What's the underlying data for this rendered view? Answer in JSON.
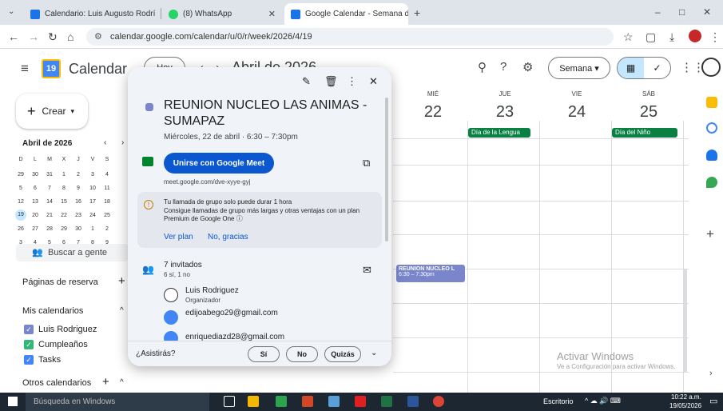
{
  "browser": {
    "tabs": [
      {
        "title": "Calendario: Luis Augusto Rodrí",
        "color": "#1a73e8"
      },
      {
        "title": "(8) WhatsApp",
        "color": "#25d366"
      },
      {
        "title": "Google Calendar - Semana del",
        "color": "#1a73e8"
      }
    ],
    "url": "calendar.google.com/calendar/u/0/r/week/2026/4/19",
    "new_tab": "+",
    "win_min": "–",
    "win_max": "□",
    "win_close": "✕"
  },
  "header": {
    "app_name": "Calendar",
    "logo_day": "19",
    "today_btn": "Hoy",
    "month_title": "Abril de 2026",
    "view_select": "Semana ▾"
  },
  "sidebar": {
    "create_label": "Crear",
    "mini_month": "Abril de 2026",
    "weekday_initials": [
      "D",
      "L",
      "M",
      "X",
      "J",
      "V",
      "S"
    ],
    "weeks": [
      [
        "29",
        "30",
        "31",
        "1",
        "2",
        "3",
        "4"
      ],
      [
        "5",
        "6",
        "7",
        "8",
        "9",
        "10",
        "11"
      ],
      [
        "12",
        "13",
        "14",
        "15",
        "16",
        "17",
        "18"
      ],
      [
        "19",
        "20",
        "21",
        "22",
        "23",
        "24",
        "25"
      ],
      [
        "26",
        "27",
        "28",
        "29",
        "30",
        "1",
        "2"
      ],
      [
        "3",
        "4",
        "5",
        "6",
        "7",
        "8",
        "9"
      ]
    ],
    "search_people": "Buscar a gente",
    "booking_pages": "Páginas de reserva",
    "my_calendars": "Mis calendarios",
    "calendars": [
      {
        "name": "Luis Rodriguez",
        "color": "#7986cb"
      },
      {
        "name": "Cumpleaños",
        "color": "#33b679"
      },
      {
        "name": "Tasks",
        "color": "#4285f4"
      }
    ],
    "other_calendars": "Otros calendarios"
  },
  "grid": {
    "days": [
      {
        "name": "MIÉ",
        "num": "22"
      },
      {
        "name": "JUE",
        "num": "23"
      },
      {
        "name": "VIE",
        "num": "24"
      },
      {
        "name": "SÁB",
        "num": "25"
      }
    ],
    "allday_events": [
      {
        "title": "Día de la Lengua"
      },
      {
        "title": "Día del Niño"
      }
    ],
    "event": {
      "title": "REUNION NUCLEO L",
      "time": "6:30 – 7:30pm",
      "color": "#7986cb"
    },
    "watermark_title": "Activar Windows",
    "watermark_sub": "Ve a Configuración para activar Windows."
  },
  "popup": {
    "title": "REUNION NUCLEO LAS ANIMAS - SUMAPAZ",
    "datetime": "Miércoles, 22 de abril  ·  6:30 – 7:30pm",
    "meet_button": "Unirse con Google Meet",
    "meet_link": "meet.google.com/dve-xyye-gyj",
    "notice_title": "Tu llamada de grupo solo puede durar 1 hora",
    "notice_body": "Consigue llamadas de grupo más largas y otras ventajas con un plan Premium de Google One ⓘ",
    "notice_link1": "Ver plan",
    "notice_link2": "No, gracias",
    "guests_count": "7 invitados",
    "guests_status": "6 sí, 1 no",
    "guests": [
      {
        "name": "Luis Rodriguez",
        "role": "Organizador"
      },
      {
        "name": "edijoabego29@gmail.com",
        "role": ""
      },
      {
        "name": "enriquediazd28@gmail.com",
        "role": ""
      }
    ],
    "rsvp_question": "¿Asistirás?",
    "rsvp_yes": "Sí",
    "rsvp_no": "No",
    "rsvp_maybe": "Quizás",
    "color": "#7986cb"
  },
  "taskbar": {
    "search": "Búsqueda en Windows",
    "desktop": "Escritorio",
    "time": "10:22 a.m.",
    "date": "19/05/2026"
  }
}
